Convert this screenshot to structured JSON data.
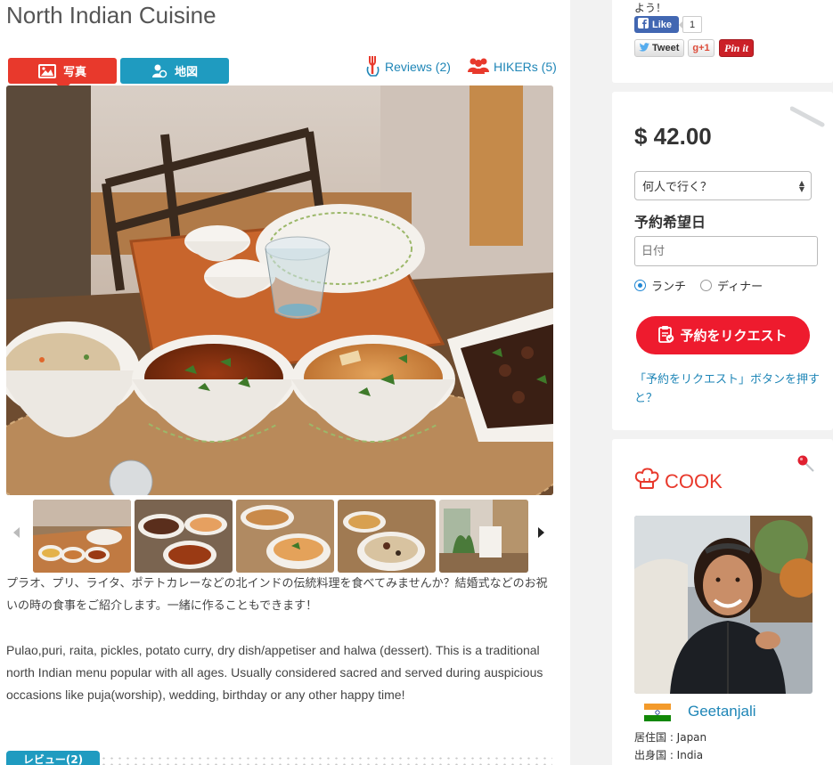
{
  "listing": {
    "title": "North Indian Cuisine",
    "tabs": {
      "photo": "写真",
      "map": "地図"
    },
    "links": {
      "reviews": "Reviews (2)",
      "hikers": "HIKERs (5)"
    },
    "description_jp": "プラオ、プリ、ライタ、ポテトカレーなどの北インドの伝統料理を食べてみませんか？結婚式などのお祝いの時の食事をご紹介します。一緒に作ることもできます！",
    "description_en": "Pulao,puri, raita, pickles, potato curry, dry dish/appetiser and halwa (dessert). This is a traditional north Indian menu popular with all ages. Usually considered sacred and served during auspicious occasions like puja(worship), wedding, birthday or any other happy time!",
    "review_tab": "レビュー(2)"
  },
  "social": {
    "top_text": "よう！",
    "like_label": "Like",
    "like_count": "1",
    "tweet_label": "Tweet",
    "gplus_label": "g+1",
    "pin_label": "Pin it"
  },
  "booking": {
    "price": "$ 42.00",
    "guests_placeholder": "何人で行く？",
    "date_label": "予約希望日",
    "date_placeholder": "日付",
    "meal_options": [
      "ランチ",
      "ディナー"
    ],
    "selected_meal": "ランチ",
    "request_button": "予約をリクエスト",
    "help_link": "「予約をリクエスト」ボタンを押すと？"
  },
  "cook": {
    "heading": "COOK",
    "name": "Geetanjali",
    "residence": "居住国 : Japan",
    "origin": "出身国 : India"
  },
  "colors": {
    "accent_red": "#e8392c",
    "accent_blue": "#1f9bc0",
    "link_blue": "#1f86b7",
    "request_red": "#ee1b2e"
  }
}
